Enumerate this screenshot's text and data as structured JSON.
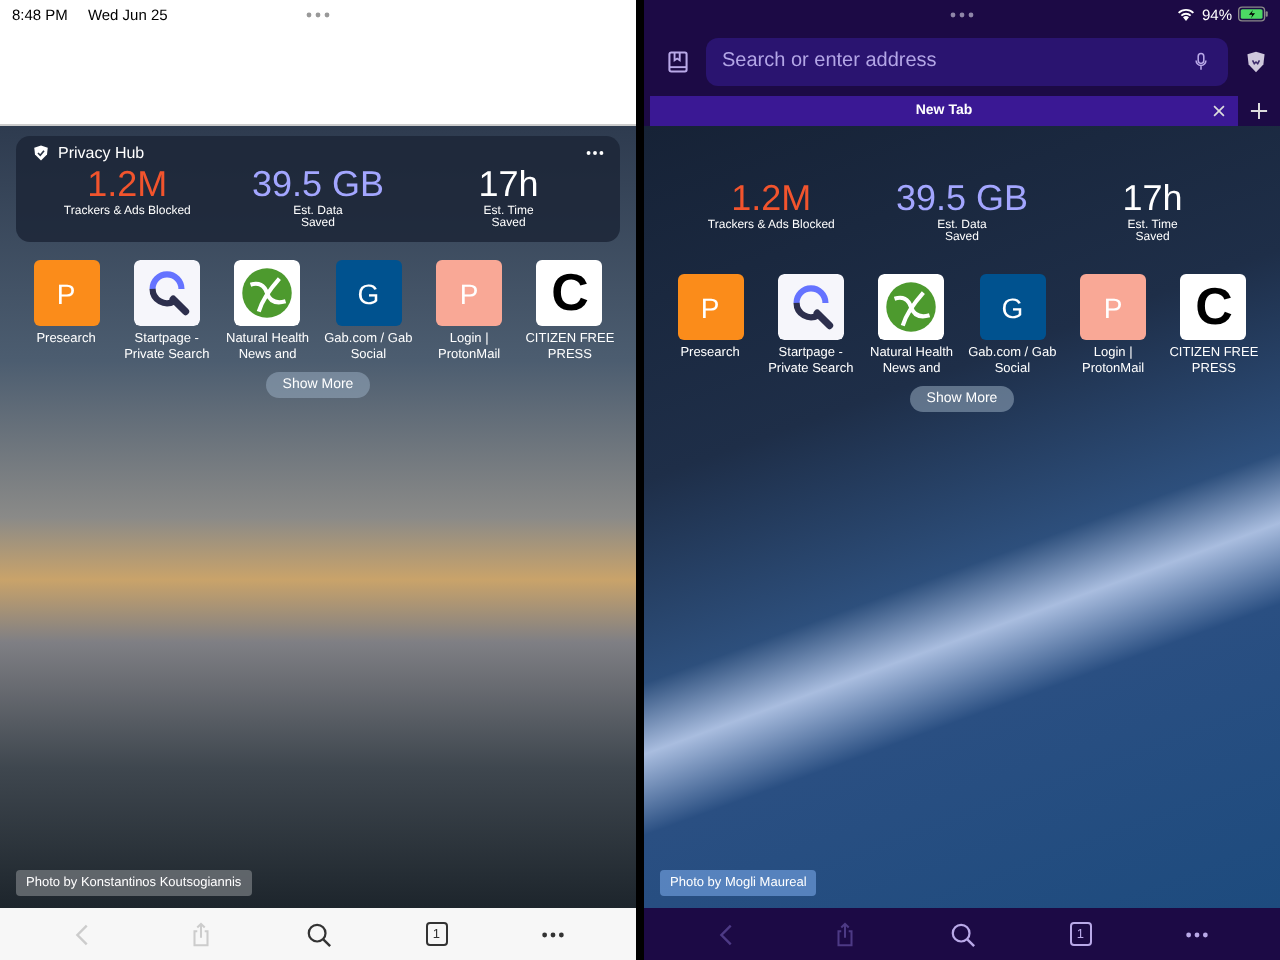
{
  "status_bar": {
    "time": "8:48 PM",
    "date": "Wed Jun 25",
    "battery": "94%"
  },
  "panes": [
    {
      "kind": "light",
      "hub_title": "Privacy Hub",
      "stats": [
        {
          "value": "1.2M",
          "label": "Trackers & Ads Blocked",
          "color": "#f2542d"
        },
        {
          "value": "39.5 GB",
          "label": "Est. Data Saved",
          "color": "#a3a6ff"
        },
        {
          "value": "17h",
          "label": "Est. Time Saved",
          "color": "#ffffff"
        }
      ],
      "favorites": [
        {
          "kind": "letter",
          "letter": "P",
          "color": "#fb8c1a",
          "label": "Presearch"
        },
        {
          "kind": "startpage",
          "label": "Startpage - Private Search"
        },
        {
          "kind": "globe",
          "label": "Natural Health News and"
        },
        {
          "kind": "letter",
          "letter": "G",
          "color": "#00528f",
          "label": "Gab.com / Gab Social"
        },
        {
          "kind": "letter",
          "letter": "P",
          "color": "#f9a896",
          "label": "Login | ProtonMail"
        },
        {
          "kind": "letter",
          "letter": "C",
          "color": "#ffffff",
          "label": "CITIZEN FREE PRESS"
        }
      ],
      "show_more": "Show More",
      "credit": "Photo by Konstantinos Koutsogiannis",
      "toolbar": [
        {
          "kind": "back",
          "disabled": true
        },
        {
          "kind": "share",
          "disabled": true
        },
        {
          "kind": "search",
          "disabled": false
        },
        {
          "kind": "tabs",
          "count": "1",
          "disabled": false
        },
        {
          "kind": "more",
          "disabled": false
        }
      ]
    },
    {
      "kind": "dark",
      "address_placeholder": "Search or enter address",
      "tab": {
        "title": "New Tab",
        "selected": true
      },
      "stats": [
        {
          "value": "1.2M",
          "label": "Trackers & Ads Blocked",
          "color": "#f2542d"
        },
        {
          "value": "39.5 GB",
          "label": "Est. Data Saved",
          "color": "#a3a6ff"
        },
        {
          "value": "17h",
          "label": "Est. Time Saved",
          "color": "#ffffff"
        }
      ],
      "favorites": [
        {
          "kind": "letter",
          "letter": "P",
          "color": "#fb8c1a",
          "label": "Presearch"
        },
        {
          "kind": "startpage",
          "label": "Startpage - Private Search"
        },
        {
          "kind": "globe",
          "label": "Natural Health News and"
        },
        {
          "kind": "letter",
          "letter": "G",
          "color": "#00528f",
          "label": "Gab.com / Gab Social"
        },
        {
          "kind": "letter",
          "letter": "P",
          "color": "#f9a896",
          "label": "Login | ProtonMail"
        },
        {
          "kind": "letter",
          "letter": "C",
          "color": "#ffffff",
          "label": "CITIZEN FREE PRESS"
        }
      ],
      "show_more": "Show More",
      "credit": "Photo by Mogli Maureal",
      "toolbar": [
        {
          "kind": "back",
          "disabled": true
        },
        {
          "kind": "share",
          "disabled": true
        },
        {
          "kind": "search",
          "disabled": false
        },
        {
          "kind": "tabs",
          "count": "1",
          "disabled": false
        },
        {
          "kind": "more",
          "disabled": false
        }
      ]
    }
  ]
}
